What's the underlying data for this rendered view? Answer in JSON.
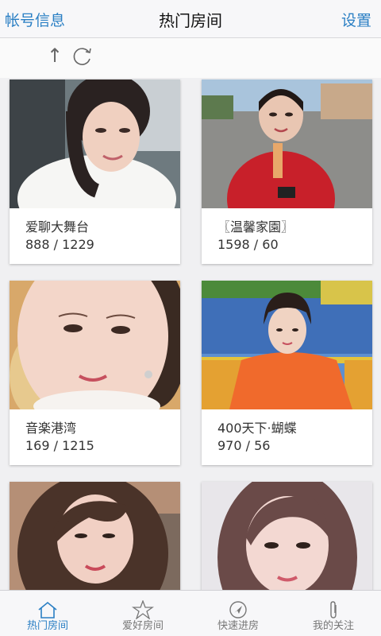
{
  "header": {
    "left_label": "帐号信息",
    "title": "热门房间",
    "right_label": "设置"
  },
  "toolbar": {
    "up_icon": "↑"
  },
  "rooms": [
    {
      "name": "爱聊大舞台",
      "stats": "888 / 1229"
    },
    {
      "name": "〖温馨家園〗",
      "stats": "1598 / 60"
    },
    {
      "name": "音楽港湾",
      "stats": "169 / 1215"
    },
    {
      "name": "400天下·蝴蝶",
      "stats": "970 / 56"
    },
    {
      "name": "",
      "stats": ""
    },
    {
      "name": "",
      "stats": ""
    }
  ],
  "tabs": [
    {
      "label": "热门房间",
      "active": true,
      "icon": "home-icon"
    },
    {
      "label": "爱好房间",
      "active": false,
      "icon": "star-icon"
    },
    {
      "label": "快速进房",
      "active": false,
      "icon": "compass-icon"
    },
    {
      "label": "我的关注",
      "active": false,
      "icon": "paperclip-icon"
    }
  ],
  "colors": {
    "accent": "#2a7fc4",
    "header_bg": "#f7f7f9",
    "page_bg": "#f0f0f2"
  }
}
